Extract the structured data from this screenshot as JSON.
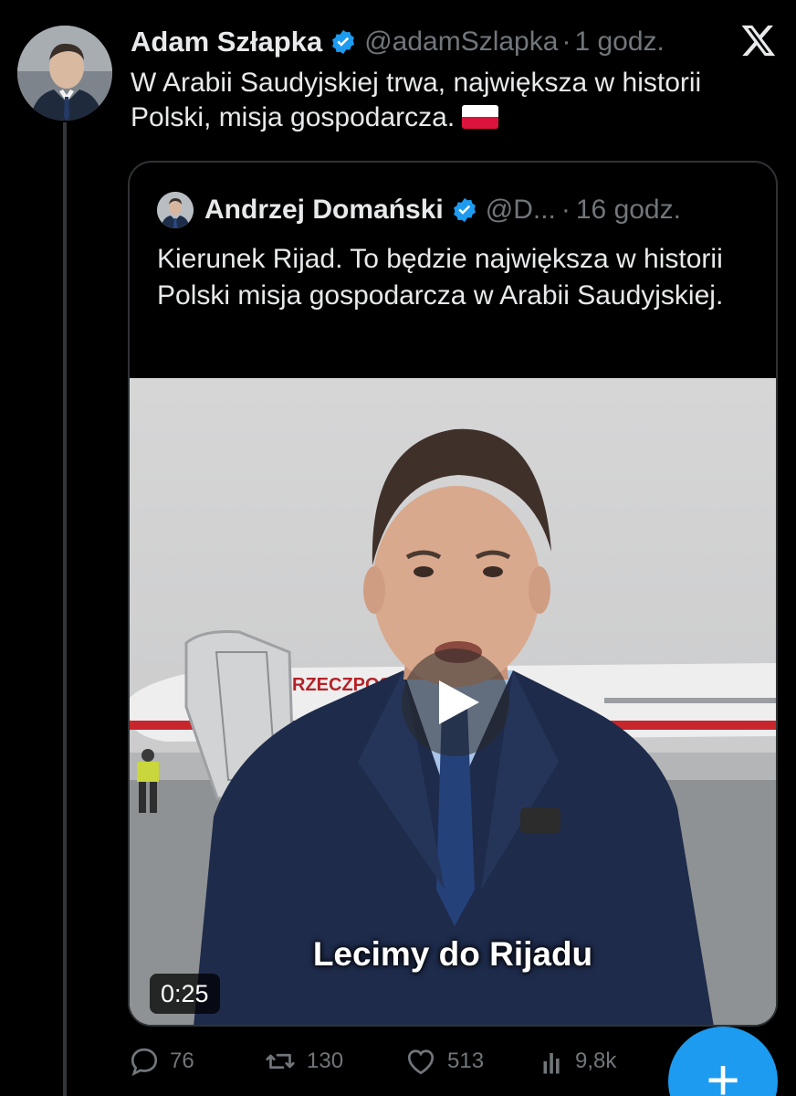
{
  "tweet": {
    "author_name": "Adam Szłapka",
    "handle": "@adamSzlapka",
    "separator": "·",
    "time": "1 godz.",
    "text": "W Arabii Saudyjskiej trwa, największa w historii Polski, misja gospodarcza."
  },
  "quote": {
    "author_name": "Andrzej Domański",
    "handle": "@D...",
    "separator": "·",
    "time": "16 godz.",
    "text": "Kierunek Rijad. To będzie największa w historii Polski misja gospodarcza w Arabii Saudyjskiej.",
    "video": {
      "caption": "Lecimy do Rijadu",
      "duration": "0:25",
      "plane_text": "RZECZPOSP"
    }
  },
  "actions": {
    "replies": "76",
    "reposts": "130",
    "likes": "513",
    "views": "9,8k"
  },
  "fab": {
    "label": "+"
  },
  "colors": {
    "background": "#000000",
    "text": "#e7e9ea",
    "muted": "#71767b",
    "accent": "#1d9bf0",
    "border": "#2f3336"
  },
  "icons": [
    "verified-badge-icon",
    "x-logo-icon",
    "poland-flag-icon",
    "play-icon",
    "reply-icon",
    "repost-icon",
    "like-icon",
    "views-icon",
    "plus-icon"
  ]
}
